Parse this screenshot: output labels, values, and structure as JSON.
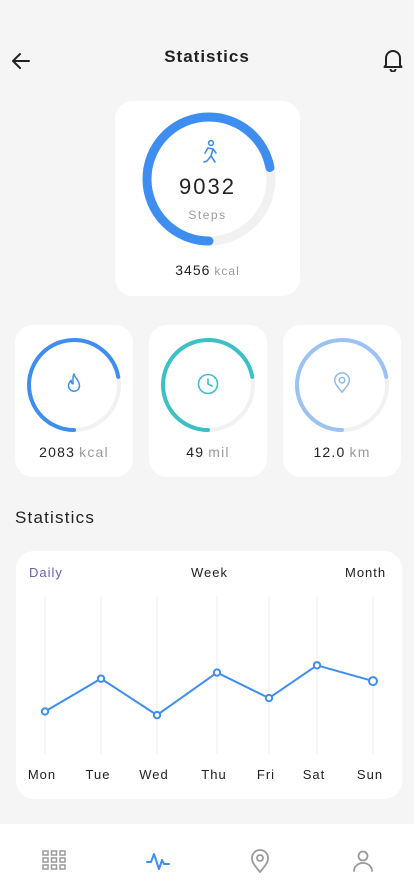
{
  "header": {
    "title": "Statistics",
    "back_icon": "arrow-left-icon",
    "notification_icon": "bell-icon"
  },
  "summary": {
    "steps_value": "9032",
    "steps_label": "Steps",
    "steps_progress": 0.72,
    "kcal_value": "3456",
    "kcal_unit": "kcal",
    "icon": "walking-person-icon"
  },
  "metrics": [
    {
      "id": "calories",
      "value": "2083",
      "unit": "kcal",
      "icon": "flame-icon",
      "progress": 0.72,
      "color": "#3d8ef0"
    },
    {
      "id": "time",
      "value": "49",
      "unit": "mil",
      "icon": "clock-icon",
      "progress": 0.72,
      "color": "#3cc0c8"
    },
    {
      "id": "distance",
      "value": "12.0",
      "unit": "km",
      "icon": "location-pin-icon",
      "progress": 0.72,
      "color": "#9cc2f3"
    }
  ],
  "statistics": {
    "title": "Statistics",
    "tabs": [
      {
        "label": "Daily",
        "active": true
      },
      {
        "label": "Week",
        "active": false
      },
      {
        "label": "Month",
        "active": false
      }
    ]
  },
  "chart_data": {
    "type": "line",
    "categories": [
      "Mon",
      "Tue",
      "Wed",
      "Thu",
      "Fri",
      "Sat",
      "Sun"
    ],
    "series": [
      {
        "values": [
          35,
          62,
          32,
          67,
          46,
          73,
          60
        ]
      }
    ],
    "ylim": [
      0,
      130
    ],
    "grid": "vertical",
    "color": "#3d8ef0"
  },
  "nav": {
    "items": [
      {
        "id": "dashboard",
        "icon": "grid-icon",
        "active": false
      },
      {
        "id": "statistics",
        "icon": "activity-icon",
        "active": true
      },
      {
        "id": "location",
        "icon": "location-pin-icon",
        "active": false
      },
      {
        "id": "profile",
        "icon": "user-icon",
        "active": false
      }
    ],
    "active_color": "#3d8ef0",
    "inactive_color": "#9a9a9a"
  },
  "colors": {
    "accent": "#3d8ef0",
    "tab_active": "#6b5fb5",
    "background": "#f5f5f5"
  }
}
